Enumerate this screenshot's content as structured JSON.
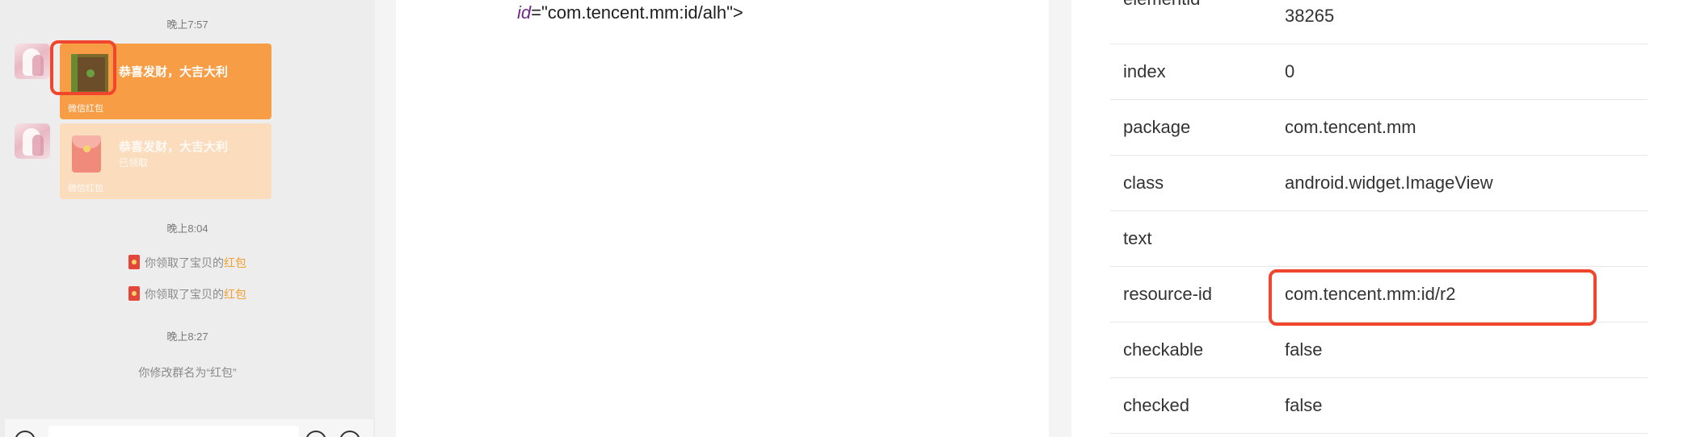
{
  "chat": {
    "time1": "晚上7:57",
    "msg1": {
      "title": "恭喜发财，大吉大利",
      "footer": "微信红包"
    },
    "msg2": {
      "title": "恭喜发财，大吉大利",
      "status": "已领取",
      "footer": "微信红包"
    },
    "time2": "晚上8:04",
    "notice1": {
      "text": "你领取了宝贝的",
      "link": "红包"
    },
    "notice2": {
      "text": "你领取了宝贝的",
      "link": "红包"
    },
    "time3": "晚上8:27",
    "rename": "你修改群名为“红包”"
  },
  "source": {
    "attr_name": "id",
    "attr_value": "=\"com.tencent.mm:id/alh\">"
  },
  "properties": [
    {
      "key": "elementid",
      "value": "38265"
    },
    {
      "key": "index",
      "value": "0"
    },
    {
      "key": "package",
      "value": "com.tencent.mm"
    },
    {
      "key": "class",
      "value": "android.widget.ImageView"
    },
    {
      "key": "text",
      "value": ""
    },
    {
      "key": "resource-id",
      "value": "com.tencent.mm:id/r2"
    },
    {
      "key": "checkable",
      "value": "false"
    },
    {
      "key": "checked",
      "value": "false"
    }
  ],
  "colors": {
    "bubble_active": "#f79d45",
    "bubble_received": "#fbdcbd",
    "highlight": "#f0462d",
    "attr_purple": "#6f2b85",
    "link_orange": "#f0a030"
  }
}
